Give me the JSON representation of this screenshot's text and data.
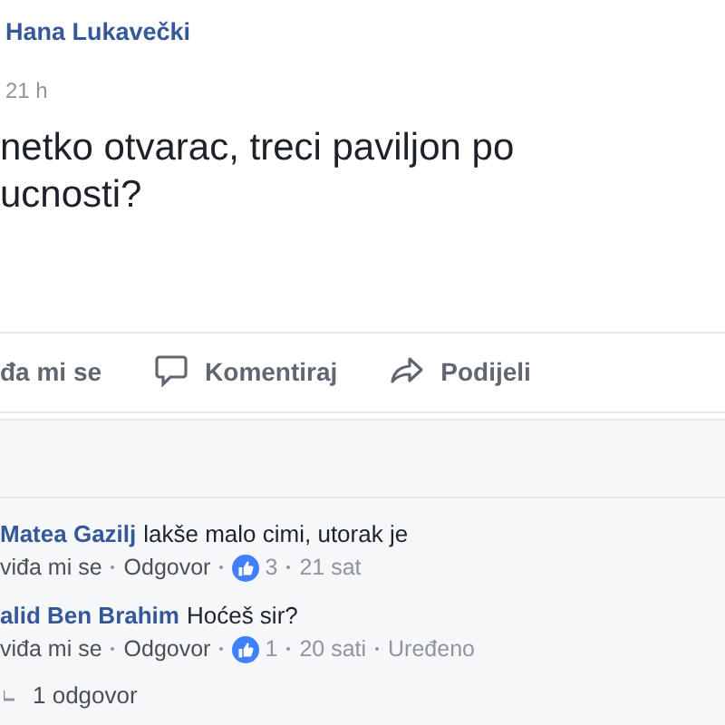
{
  "post": {
    "author": "Hana Lukavečki",
    "time": "21 h",
    "text": "netko otvarac, treci paviljon po\nucnosti?"
  },
  "actions": [
    {
      "label": "đa mi se",
      "kind": "like"
    },
    {
      "label": "Komentiraj",
      "kind": "comment"
    },
    {
      "label": "Podijeli",
      "kind": "share"
    }
  ],
  "comments": [
    {
      "author": "Matea Gazilj",
      "text": "lakše malo cimi, utorak je",
      "like": "viđa mi se",
      "reply": "Odgovor",
      "reactions": "3",
      "time": "21 sat"
    },
    {
      "author": "alid Ben Brahim",
      "text": "Hoćeš sir?",
      "like": "viđa mi se",
      "reply": "Odgovor",
      "reactions": "1",
      "time": "20 sati",
      "edited": "Uređeno"
    }
  ],
  "replies": {
    "label": "1 odgovor"
  }
}
